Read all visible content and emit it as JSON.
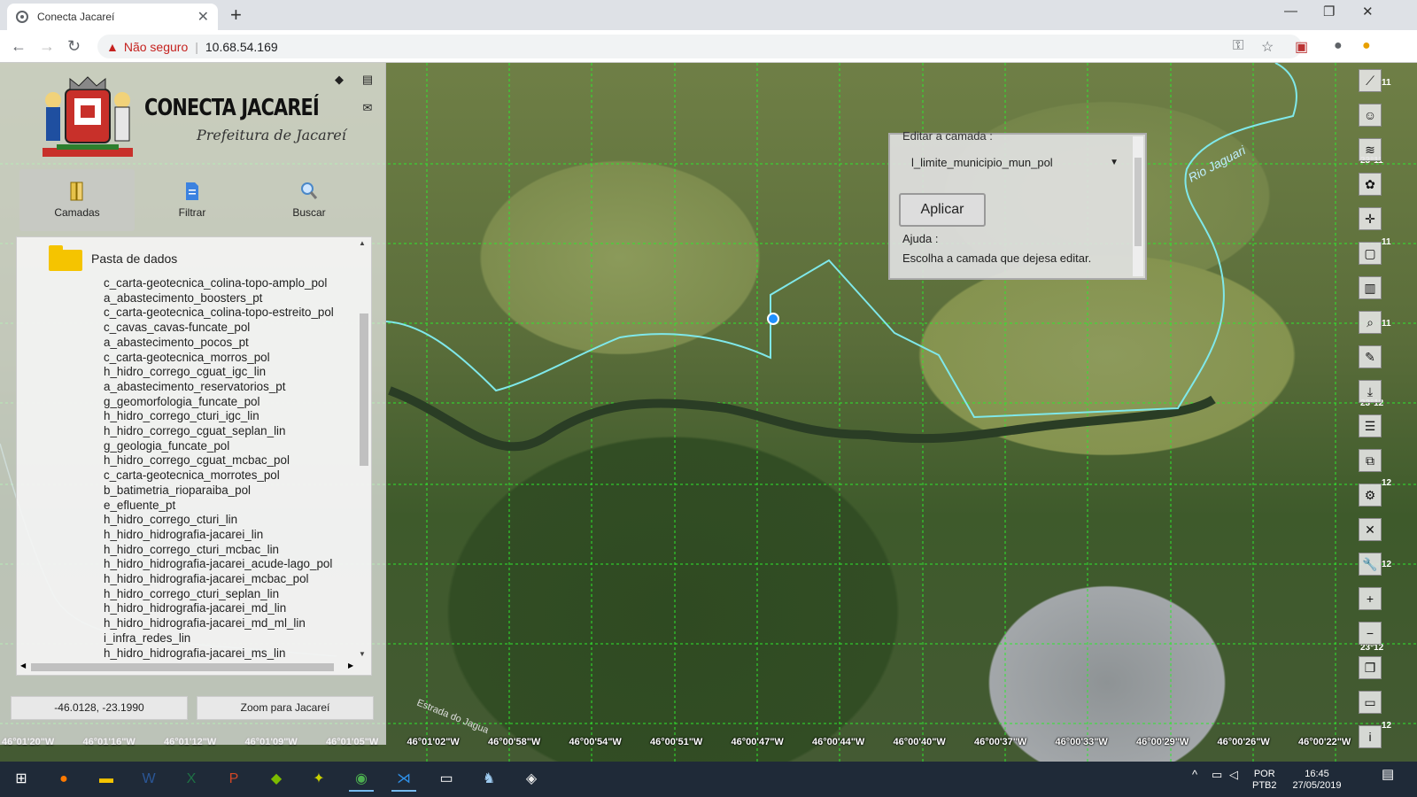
{
  "browser": {
    "tab_title": "Conecta Jacareí",
    "new_tab": "+",
    "tab_close": "✕",
    "win_minimize": "—",
    "win_maximize": "❐",
    "win_close": "✕",
    "not_secure": "Não seguro",
    "url": "10.68.54.169",
    "back": "←",
    "forward": "→",
    "reload": "↻"
  },
  "panel": {
    "brand_title": "CONECTA JACAREÍ",
    "brand_subtitle": "Prefeitura de Jacareí",
    "menu": {
      "layers_label": "Camadas",
      "filter_label": "Filtrar",
      "search_label": "Buscar"
    },
    "folder_name": "Pasta de dados",
    "layers": [
      "c_carta-geotecnica_colina-topo-amplo_pol",
      "a_abastecimento_boosters_pt",
      "c_carta-geotecnica_colina-topo-estreito_pol",
      "c_cavas_cavas-funcate_pol",
      "a_abastecimento_pocos_pt",
      "c_carta-geotecnica_morros_pol",
      "h_hidro_corrego_cguat_igc_lin",
      "a_abastecimento_reservatorios_pt",
      "g_geomorfologia_funcate_pol",
      "h_hidro_corrego_cturi_igc_lin",
      "h_hidro_corrego_cguat_seplan_lin",
      "g_geologia_funcate_pol",
      "h_hidro_corrego_cguat_mcbac_pol",
      "c_carta-geotecnica_morrotes_pol",
      "b_batimetria_rioparaiba_pol",
      "e_efluente_pt",
      "h_hidro_corrego_cturi_lin",
      "h_hidro_hidrografia-jacarei_lin",
      "h_hidro_corrego_cturi_mcbac_lin",
      "h_hidro_hidrografia-jacarei_acude-lago_pol",
      "h_hidro_hidrografia-jacarei_mcbac_pol",
      "h_hidro_corrego_cturi_seplan_lin",
      "h_hidro_hidrografia-jacarei_md_lin",
      "h_hidro_hidrografia-jacarei_md_ml_lin",
      "i_infra_redes_lin",
      "h_hidro_hidrografia-jacarei_ms_lin"
    ],
    "coordinates": "-46.0128, -23.1990",
    "zoom_button": "Zoom para Jacareí"
  },
  "edit_dialog": {
    "title": "Editar a camada :",
    "selected_layer": "l_limite_municipio_mun_pol",
    "apply_label": "Aplicar",
    "help_label": "Ajuda :",
    "help_text": "Escolha a camada que dejesa editar."
  },
  "map": {
    "river_label": "Rio Jaguari",
    "road_label": "Estrada do Jagua",
    "longitude_ticks": [
      "46°01'20\"W",
      "46°01'16\"W",
      "46°01'12\"W",
      "46°01'09\"W",
      "46°01'05\"W",
      "46°01'02\"W",
      "46°00'58\"W",
      "46°00'54\"W",
      "46°00'51\"W",
      "46°00'47\"W",
      "46°00'44\"W",
      "46°00'40\"W",
      "46°00'37\"W",
      "46°00'33\"W",
      "46°00'29\"W",
      "46°00'26\"W",
      "46°00'22\"W"
    ],
    "right_labels": [
      "11",
      "23°11",
      "11",
      "11",
      "23°12",
      "12",
      "12",
      "23°12",
      "12"
    ]
  },
  "right_tools": [
    "measure-icon",
    "user-location-icon",
    "layers-icon",
    "palette-icon",
    "crosshair-icon",
    "document-icon",
    "chart-icon",
    "zoom-search-icon",
    "edit-icon",
    "download-icon",
    "table-icon",
    "screen-select-icon",
    "settings-icon",
    "tools-icon",
    "wrench-icon",
    "zoom-in-icon",
    "zoom-out-icon",
    "copy-icon",
    "monitor-icon",
    "info-icon"
  ],
  "taskbar": {
    "lang_top": "POR",
    "lang_bottom": "PTB2",
    "time": "16:45",
    "date": "27/05/2019"
  }
}
